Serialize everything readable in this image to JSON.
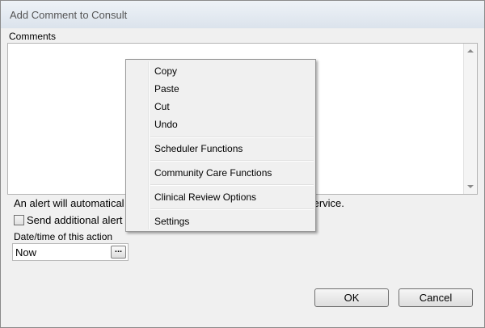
{
  "window": {
    "title": "Add Comment to Consult"
  },
  "comments": {
    "label": "Comments",
    "value": ""
  },
  "alert": {
    "text_visible_start": "An alert will automatical",
    "text_visible_end": "s service.",
    "checkbox_label": "Send additional alert",
    "checkbox_checked": false
  },
  "datetime": {
    "label": "Date/time of this action",
    "value": "Now",
    "picker_label": "..."
  },
  "buttons": {
    "ok": "OK",
    "cancel": "Cancel"
  },
  "context_menu": {
    "items": [
      {
        "label": "Copy"
      },
      {
        "label": "Paste"
      },
      {
        "label": "Cut"
      },
      {
        "label": "Undo"
      },
      {
        "label": "Scheduler Functions"
      },
      {
        "label": "Community Care Functions"
      },
      {
        "label": "Clinical Review Options"
      },
      {
        "label": "Settings"
      }
    ]
  },
  "icons": {
    "scroll_up": "arrow-up-icon",
    "scroll_down": "arrow-down-icon"
  }
}
